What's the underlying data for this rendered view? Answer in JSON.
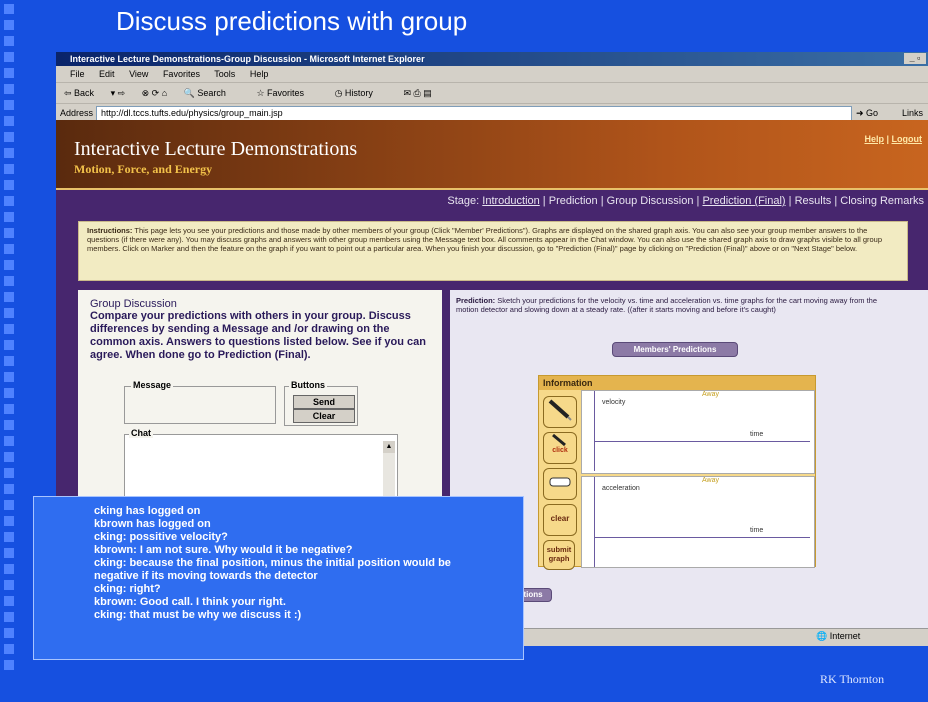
{
  "slide": {
    "title": "Discuss predictions with group",
    "footer": "RK Thornton"
  },
  "browser": {
    "window_title": "Interactive Lecture Demonstrations-Group Discussion - Microsoft Internet Explorer",
    "menu": [
      "File",
      "Edit",
      "View",
      "Favorites",
      "Tools",
      "Help"
    ],
    "toolbar": [
      "Back",
      "Search",
      "Favorites",
      "History"
    ],
    "address_label": "Address",
    "url": "http://dl.tccs.tufts.edu/physics/group_main.jsp",
    "go_label": "Go",
    "links_label": "Links",
    "status_zone": "Internet"
  },
  "app": {
    "title": "Interactive Lecture Demonstrations",
    "subtitle": "Motion, Force, and Energy",
    "help": "Help",
    "logout": "Logout",
    "stage_label": "Stage:",
    "stages": [
      "Introduction",
      "Prediction",
      "Group Discussion",
      "Prediction (Final)",
      "Results",
      "Closing Remarks"
    ]
  },
  "instructions": {
    "label": "Instructions:",
    "text": "This page lets you see your predictions and those made by other members of your group (Click \"Member' Predictions\"). Graphs are displayed on the shared graph axis. You can also see your group member answers to the questions (if there were any). You may discuss graphs and answers with other group members using the Message text box. All comments appear in the Chat window. You can also use the shared graph axis to draw graphs visible to all group members. Click on Marker and then the feature on the graph if you want to point out a particular area. When you finish your discussion, go to \"Prediction (Final)\" page by clicking on \"Prediction (Final)\" above or on \"Next Stage\" below."
  },
  "group_discussion": {
    "title": "Group Discussion",
    "description": "Compare your predictions with others in your group. Discuss differences by sending a Message and /or drawing on the common axis. Answers to questions listed below. See if you can agree. When done go to Prediction (Final).",
    "message_label": "Message",
    "buttons_label": "Buttons",
    "send": "Send",
    "clear": "Clear",
    "chat_label": "Chat"
  },
  "prediction": {
    "label": "Prediction:",
    "text": "Sketch your predictions for the velocity vs. time and acceleration vs. time graphs for the cart moving away from the motion detector and slowing down at a steady rate. ((after it starts moving and before it's caught)",
    "members_button": "Members' Predictions",
    "info_title": "Information",
    "tools": {
      "click": "click",
      "clear": "clear",
      "submit": "submit graph"
    },
    "graph1": {
      "ylabel": "velocity",
      "away": "Away",
      "xlabel": "time"
    },
    "graph2": {
      "ylabel": "acceleration",
      "away": "Away",
      "xlabel": "time"
    },
    "bottom_button": "tions"
  },
  "chat_overlay": [
    "cking has logged on",
    "kbrown has logged on",
    "cking: possitive velocity?",
    "kbrown: I am not sure. Why would it be negative?",
    "cking: because the final position, minus the initial position would be",
    "negative if its moving towards the detector",
    "cking: right?",
    "kbrown: Good call. I think your right.",
    "cking: that must be why we discuss it :)"
  ]
}
